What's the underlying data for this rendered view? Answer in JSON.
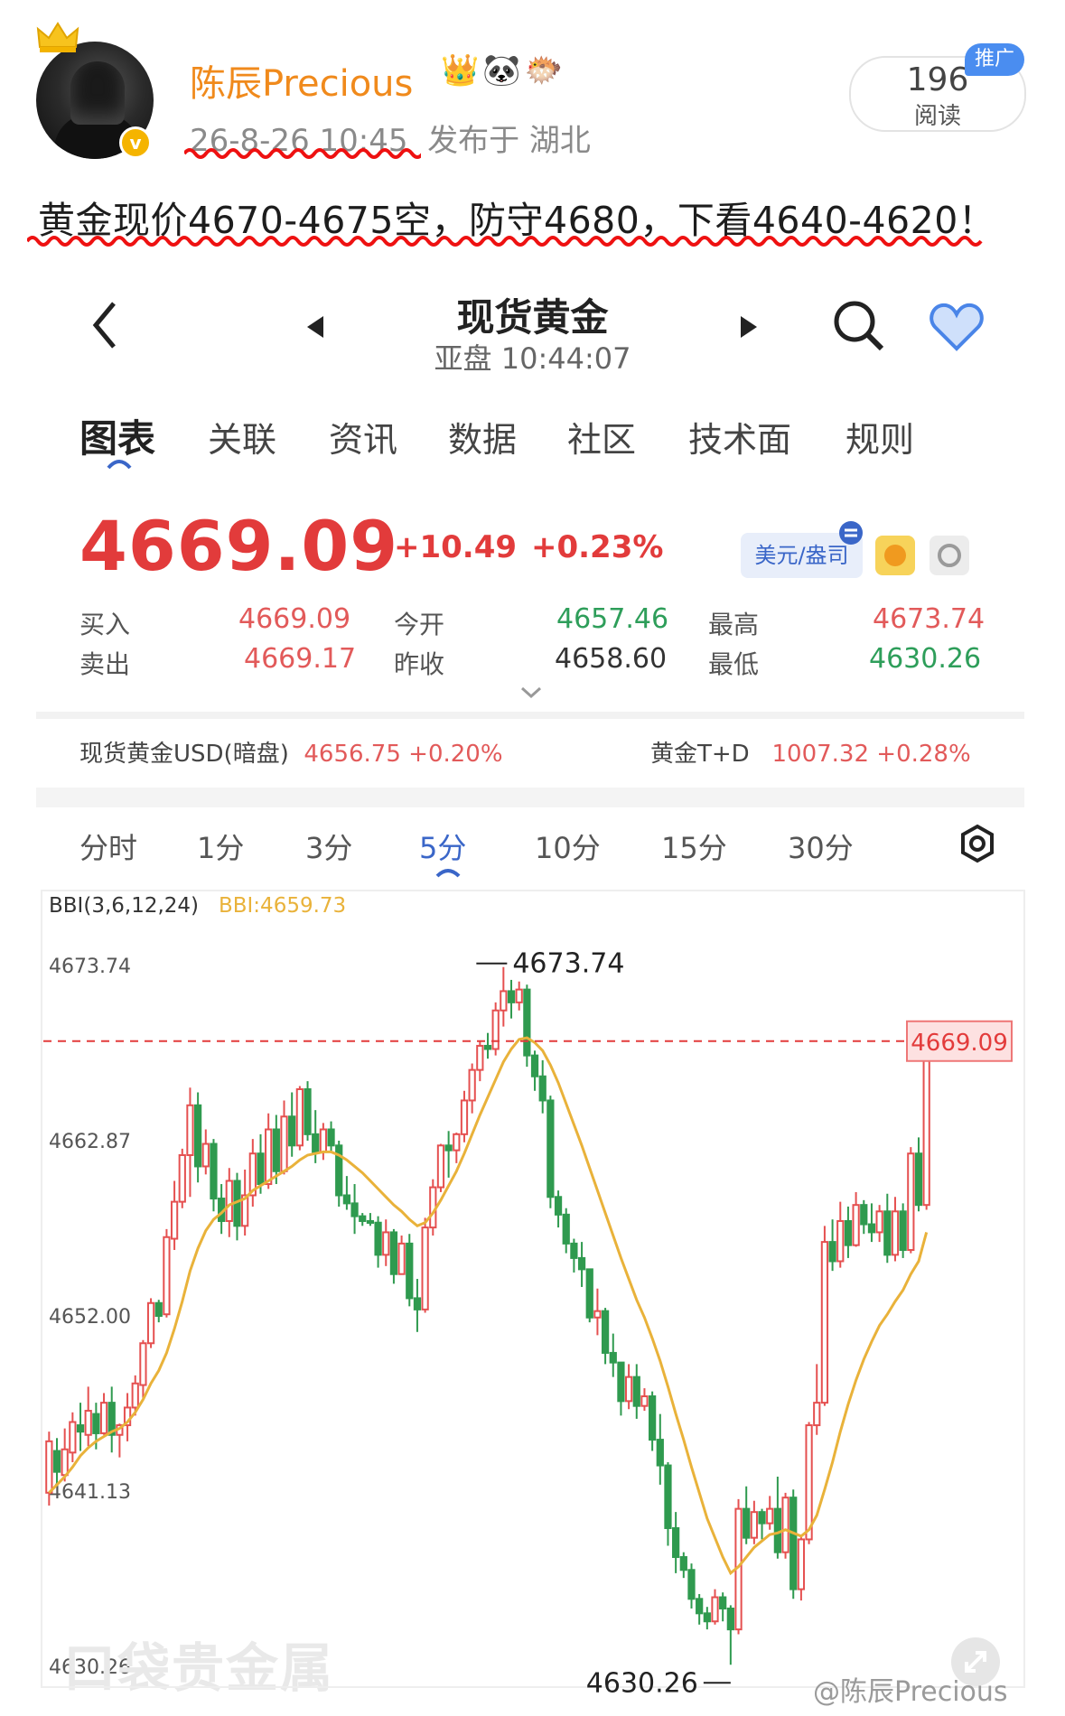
{
  "post": {
    "username": "陈辰Precious",
    "badges": [
      "crown-emoji",
      "panda-emoji",
      "fish-emoji"
    ],
    "time": "26-8-26 10:45",
    "location": "发布于 湖北",
    "reads_count": "196",
    "reads_label": "阅读",
    "promo_label": "推广",
    "text": "黄金现价4670-4675空，防守4680，下看4640-4620！"
  },
  "app": {
    "title": "现货黄金",
    "session": "亚盘 10:44:07",
    "tabs": [
      "图表",
      "关联",
      "资讯",
      "数据",
      "社区",
      "技术面",
      "规则"
    ],
    "price": "4669.09",
    "change": "+10.49",
    "change_pct": "+0.23%",
    "currency_button": "美元/盎司",
    "quotes": {
      "buy_label": "买入",
      "buy": "4669.09",
      "sell_label": "卖出",
      "sell": "4669.17",
      "open_label": "今开",
      "open": "4657.46",
      "prev_label": "昨收",
      "prev": "4658.60",
      "high_label": "最高",
      "high": "4673.74",
      "low_label": "最低",
      "low": "4630.26"
    },
    "ref": {
      "usd_label": "现货黄金USD(暗盘)",
      "usd_value": "4656.75",
      "usd_pct": "+0.20%",
      "td_label": "黄金T+D",
      "td_value": "1007.32",
      "td_pct": "+0.28%"
    },
    "ktabs": [
      "分时",
      "1分",
      "3分",
      "5分",
      "10分",
      "15分",
      "30分"
    ],
    "chart_watermark": "口袋贵金属",
    "watermark": "@陈辰Precious"
  },
  "chart_data": {
    "type": "candlestick",
    "indicator_label": "BBI(3,6,12,24)",
    "indicator_value": "BBI:4659.73",
    "y_ticks": [
      "4673.74",
      "4662.87",
      "4652.00",
      "4641.13",
      "4630.26"
    ],
    "ylim": [
      4630.26,
      4673.74
    ],
    "high_marker": "4673.74",
    "low_marker": "4630.26",
    "last_price_marker": "4669.09",
    "colors": {
      "up": "#e55050",
      "down": "#2f9a4f",
      "bbi": "#e9b23a",
      "last": "#e33b3b"
    },
    "candles": [
      [
        4641.0,
        4644.2,
        4640.2,
        4644.8
      ],
      [
        4643.6,
        4642.3,
        4641.4,
        4644.4
      ],
      [
        4642.1,
        4643.7,
        4641.7,
        4645.0
      ],
      [
        4643.5,
        4645.4,
        4642.9,
        4646.0
      ],
      [
        4645.2,
        4644.8,
        4643.6,
        4646.6
      ],
      [
        4644.6,
        4646.1,
        4643.9,
        4647.6
      ],
      [
        4645.9,
        4644.7,
        4643.7,
        4646.6
      ],
      [
        4644.7,
        4646.6,
        4644.6,
        4647.2
      ],
      [
        4646.6,
        4644.6,
        4643.5,
        4647.6
      ],
      [
        4644.6,
        4645.2,
        4643.2,
        4645.3
      ],
      [
        4645.2,
        4646.3,
        4644.2,
        4647.2
      ],
      [
        4646.3,
        4647.8,
        4645.8,
        4648.3
      ],
      [
        4647.7,
        4650.3,
        4646.9,
        4650.5
      ],
      [
        4650.3,
        4652.8,
        4650.0,
        4653.1
      ],
      [
        4652.8,
        4652.0,
        4651.6,
        4653.0
      ],
      [
        4652.1,
        4656.9,
        4651.9,
        4657.4
      ],
      [
        4656.8,
        4659.1,
        4656.1,
        4660.4
      ],
      [
        4659.1,
        4662.0,
        4658.7,
        4662.4
      ],
      [
        4662.0,
        4665.1,
        4659.4,
        4666.2
      ],
      [
        4665.1,
        4661.3,
        4660.3,
        4665.9
      ],
      [
        4661.3,
        4662.7,
        4660.8,
        4663.6
      ],
      [
        4662.7,
        4659.3,
        4658.5,
        4663.0
      ],
      [
        4659.3,
        4657.9,
        4657.1,
        4660.2
      ],
      [
        4657.9,
        4660.4,
        4656.9,
        4661.2
      ],
      [
        4660.4,
        4657.6,
        4656.7,
        4660.9
      ],
      [
        4657.6,
        4659.5,
        4657.0,
        4661.1
      ],
      [
        4659.5,
        4662.1,
        4658.8,
        4663.0
      ],
      [
        4662.1,
        4660.2,
        4659.6,
        4663.3
      ],
      [
        4660.2,
        4663.6,
        4659.9,
        4664.6
      ],
      [
        4663.6,
        4661.0,
        4660.2,
        4664.5
      ],
      [
        4661.0,
        4664.4,
        4660.8,
        4665.4
      ],
      [
        4664.4,
        4662.6,
        4661.9,
        4665.9
      ],
      [
        4662.6,
        4666.1,
        4662.3,
        4666.3
      ],
      [
        4666.1,
        4663.3,
        4662.9,
        4666.6
      ],
      [
        4663.3,
        4662.2,
        4661.5,
        4664.8
      ],
      [
        4662.2,
        4663.6,
        4661.7,
        4664.0
      ],
      [
        4663.6,
        4662.6,
        4662.2,
        4664.1
      ],
      [
        4662.6,
        4659.5,
        4658.8,
        4662.9
      ],
      [
        4659.5,
        4659.0,
        4658.6,
        4660.7
      ],
      [
        4659.0,
        4658.2,
        4657.1,
        4660.2
      ],
      [
        4658.2,
        4657.9,
        4657.6,
        4658.4
      ],
      [
        4657.9,
        4657.8,
        4657.6,
        4658.4
      ],
      [
        4657.8,
        4655.8,
        4655.0,
        4658.2
      ],
      [
        4655.8,
        4657.2,
        4655.1,
        4658.0
      ],
      [
        4657.2,
        4654.6,
        4654.0,
        4657.4
      ],
      [
        4654.6,
        4656.5,
        4654.6,
        4657.0
      ],
      [
        4656.5,
        4653.1,
        4652.6,
        4657.1
      ],
      [
        4653.1,
        4652.4,
        4651.0,
        4654.3
      ],
      [
        4652.4,
        4657.5,
        4652.2,
        4658.1
      ],
      [
        4657.5,
        4660.0,
        4657.0,
        4660.5
      ],
      [
        4660.0,
        4662.6,
        4659.7,
        4662.7
      ],
      [
        4662.6,
        4662.3,
        4660.6,
        4663.5
      ],
      [
        4662.3,
        4663.3,
        4661.5,
        4663.4
      ],
      [
        4663.3,
        4665.4,
        4662.8,
        4666.0
      ],
      [
        4665.4,
        4667.3,
        4664.6,
        4667.7
      ],
      [
        4667.3,
        4668.8,
        4666.6,
        4669.1
      ],
      [
        4668.8,
        4668.6,
        4668.0,
        4669.6
      ],
      [
        4668.6,
        4671.0,
        4668.2,
        4671.5
      ],
      [
        4671.0,
        4672.2,
        4670.0,
        4673.7
      ],
      [
        4672.2,
        4671.5,
        4670.5,
        4672.9
      ],
      [
        4671.5,
        4672.3,
        4671.0,
        4672.8
      ],
      [
        4672.3,
        4668.2,
        4667.5,
        4672.6
      ],
      [
        4668.2,
        4666.9,
        4666.0,
        4668.5
      ],
      [
        4666.9,
        4665.4,
        4664.6,
        4667.9
      ],
      [
        4665.4,
        4659.4,
        4658.7,
        4665.7
      ],
      [
        4659.4,
        4658.3,
        4657.5,
        4659.8
      ],
      [
        4658.3,
        4656.5,
        4655.9,
        4658.7
      ],
      [
        4656.5,
        4655.6,
        4654.7,
        4656.8
      ],
      [
        4655.6,
        4654.9,
        4653.8,
        4656.6
      ],
      [
        4654.9,
        4651.9,
        4651.6,
        4654.6
      ],
      [
        4651.9,
        4652.3,
        4650.8,
        4653.7
      ],
      [
        4652.3,
        4649.7,
        4649.0,
        4652.5
      ],
      [
        4649.7,
        4649.1,
        4648.2,
        4650.9
      ],
      [
        4649.1,
        4646.7,
        4645.8,
        4648.0
      ],
      [
        4646.7,
        4648.2,
        4646.2,
        4649.0
      ],
      [
        4648.2,
        4646.4,
        4645.6,
        4649.0
      ],
      [
        4646.4,
        4647.0,
        4646.1,
        4647.5
      ],
      [
        4647.0,
        4644.3,
        4643.6,
        4647.3
      ],
      [
        4644.3,
        4642.7,
        4641.5,
        4645.9
      ],
      [
        4642.7,
        4638.8,
        4637.7,
        4642.9
      ],
      [
        4638.8,
        4637.0,
        4636.0,
        4639.8
      ],
      [
        4637.0,
        4636.2,
        4635.7,
        4637.3
      ],
      [
        4636.2,
        4634.4,
        4633.8,
        4636.6
      ],
      [
        4634.4,
        4633.5,
        4632.8,
        4634.7
      ],
      [
        4633.5,
        4633.0,
        4632.5,
        4633.9
      ],
      [
        4633.0,
        4634.5,
        4632.8,
        4635.0
      ],
      [
        4634.5,
        4633.8,
        4633.0,
        4634.8
      ],
      [
        4633.8,
        4632.5,
        4630.3,
        4634.0
      ],
      [
        4632.5,
        4640.0,
        4632.2,
        4640.6
      ],
      [
        4640.0,
        4638.2,
        4637.8,
        4641.4
      ],
      [
        4638.2,
        4639.8,
        4637.8,
        4640.5
      ],
      [
        4639.8,
        4639.1,
        4638.1,
        4640.0
      ],
      [
        4639.1,
        4640.0,
        4638.7,
        4640.8
      ],
      [
        4640.0,
        4637.3,
        4636.9,
        4642.0
      ],
      [
        4637.3,
        4640.7,
        4636.9,
        4641.0
      ],
      [
        4640.7,
        4635.0,
        4634.4,
        4641.2
      ],
      [
        4635.0,
        4638.1,
        4634.3,
        4638.4
      ],
      [
        4638.1,
        4645.2,
        4637.8,
        4645.4
      ],
      [
        4645.2,
        4646.6,
        4644.6,
        4649.0
      ],
      [
        4646.6,
        4656.6,
        4646.4,
        4657.6
      ],
      [
        4656.6,
        4655.4,
        4654.8,
        4658.0
      ],
      [
        4655.4,
        4657.9,
        4655.0,
        4659.1
      ],
      [
        4657.9,
        4656.4,
        4655.6,
        4658.8
      ],
      [
        4656.4,
        4658.9,
        4656.3,
        4659.7
      ],
      [
        4658.9,
        4657.7,
        4657.1,
        4659.2
      ],
      [
        4657.7,
        4657.2,
        4656.6,
        4659.0
      ],
      [
        4657.2,
        4658.5,
        4656.6,
        4658.9
      ],
      [
        4658.5,
        4655.8,
        4655.3,
        4659.6
      ],
      [
        4655.8,
        4658.5,
        4655.4,
        4659.4
      ],
      [
        4658.5,
        4656.1,
        4655.6,
        4659.0
      ],
      [
        4656.1,
        4662.1,
        4655.9,
        4662.5
      ],
      [
        4662.1,
        4658.9,
        4658.5,
        4663.1
      ],
      [
        4658.9,
        4669.1,
        4658.6,
        4670.2
      ]
    ],
    "bbi": [
      4641.0,
      4641.5,
      4642.0,
      4642.6,
      4643.3,
      4643.8,
      4644.2,
      4644.5,
      4644.8,
      4645.0,
      4645.4,
      4646.0,
      4646.8,
      4647.8,
      4648.6,
      4649.7,
      4651.2,
      4652.9,
      4654.8,
      4656.2,
      4657.3,
      4658.0,
      4658.4,
      4658.9,
      4659.1,
      4659.3,
      4659.8,
      4660.1,
      4660.4,
      4660.7,
      4661.0,
      4661.3,
      4661.7,
      4662.0,
      4662.1,
      4662.2,
      4662.2,
      4662.0,
      4661.7,
      4661.3,
      4660.9,
      4660.4,
      4659.9,
      4659.4,
      4658.9,
      4658.5,
      4658.0,
      4657.6,
      4657.8,
      4658.4,
      4659.2,
      4660.1,
      4661.0,
      4662.1,
      4663.3,
      4664.5,
      4665.6,
      4666.7,
      4667.8,
      4668.6,
      4669.2,
      4669.3,
      4669.0,
      4668.5,
      4667.6,
      4666.5,
      4665.2,
      4663.9,
      4662.6,
      4661.2,
      4659.8,
      4658.4,
      4657.0,
      4655.6,
      4654.3,
      4653.0,
      4651.9,
      4650.6,
      4649.2,
      4647.6,
      4645.9,
      4644.3,
      4642.6,
      4641.0,
      4639.4,
      4638.2,
      4637.0,
      4636.0,
      4636.4,
      4637.0,
      4637.6,
      4638.0,
      4638.4,
      4638.5,
      4638.7,
      4638.5,
      4638.3,
      4638.7,
      4639.6,
      4641.2,
      4642.9,
      4644.8,
      4646.5,
      4648.0,
      4649.3,
      4650.4,
      4651.4,
      4652.1,
      4652.9,
      4653.6,
      4654.6,
      4655.4,
      4657.2
    ]
  }
}
